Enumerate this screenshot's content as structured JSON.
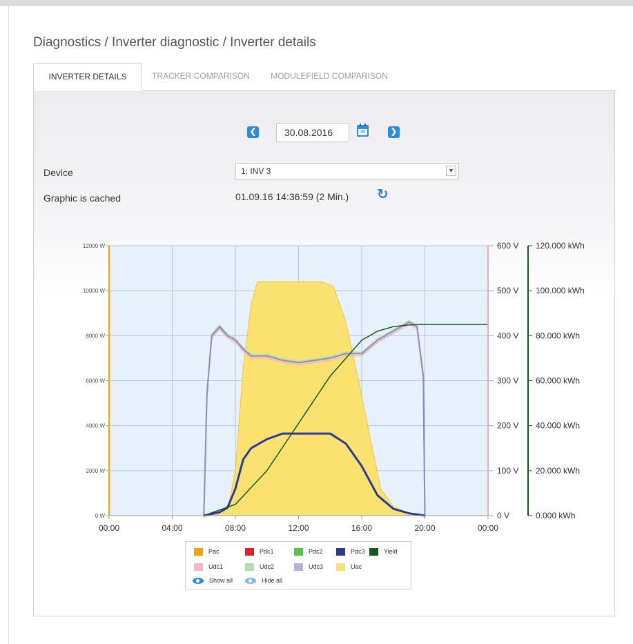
{
  "breadcrumb": "Diagnostics / Inverter diagnostic / Inverter details",
  "tabs": [
    {
      "label": "INVERTER DETAILS",
      "active": true
    },
    {
      "label": "TRACKER COMPARISON",
      "active": false
    },
    {
      "label": "MODULEFIELD COMPARISON",
      "active": false
    }
  ],
  "date_nav": {
    "prev_icon": "chevron-left-icon",
    "date": "30.08.2016",
    "calendar_icon": "calendar-icon",
    "calendar_day": "30",
    "next_icon": "chevron-right-icon"
  },
  "device": {
    "label": "Device",
    "selected": "1: INV 3"
  },
  "cache": {
    "label": "Graphic is cached",
    "value": "01.09.16 14:36:59 (2 Min.)",
    "refresh_icon": "refresh-icon"
  },
  "colors": {
    "Pac": "#f5a300",
    "Pdc1": "#e3222a",
    "Pdc2": "#5cc04a",
    "Pdc3": "#2a3a96",
    "Yield": "#17561c",
    "Udc1": "#f4b8c4",
    "Udc2": "#b8dbb0",
    "Udc3": "#b4b2d8",
    "Uac": "#fbe270",
    "plot_bg": "#e7f1fb",
    "grid": "#b8c8d8",
    "accent": "#2f8bd6"
  },
  "chart_data": {
    "type": "area",
    "x_unit": "time of day",
    "x_ticks": [
      "00:00",
      "04:00",
      "08:00",
      "12:00",
      "16:00",
      "20:00",
      "00:00"
    ],
    "x_range": [
      0,
      24
    ],
    "y_left": {
      "ticks": [
        "0 W",
        "2000 W",
        "4000 W",
        "6000 W",
        "8000 W",
        "10000 W",
        "12000 W"
      ],
      "range": [
        0,
        12000
      ]
    },
    "y_right_voltage": {
      "ticks": [
        "0 V",
        "100 V",
        "200 V",
        "300 V",
        "400 V",
        "500 V",
        "600 V"
      ],
      "range": [
        0,
        600
      ]
    },
    "y_right_yield": {
      "ticks": [
        "0.000 kWh",
        "20.000 kWh",
        "40.000 kWh",
        "60.000 kWh",
        "80.000 kWh",
        "100.000 kWh",
        "120.000 kWh"
      ],
      "range": [
        0,
        120
      ]
    },
    "grid": true,
    "legend_placement": "bottom-center",
    "series": [
      {
        "name": "Uac",
        "axis": "V",
        "x": [
          6.5,
          7.2,
          7.6,
          8.0,
          8.5,
          9.0,
          9.4,
          10.5,
          12.0,
          13.5,
          14.2,
          15.0,
          15.8,
          16.5,
          17.2,
          18.0,
          19.0,
          20.0
        ],
        "values": [
          0,
          5,
          30,
          100,
          330,
          470,
          520,
          520,
          520,
          520,
          510,
          430,
          300,
          180,
          60,
          20,
          5,
          0
        ]
      },
      {
        "name": "Udc3",
        "axis": "V",
        "x": [
          6.0,
          6.2,
          6.5,
          7.0,
          7.5,
          8.0,
          8.5,
          9.0,
          10.0,
          11.0,
          12.0,
          13.0,
          14.0,
          15.0,
          16.0,
          17.0,
          18.0,
          19.0,
          19.5,
          19.9,
          20.0
        ],
        "values": [
          0,
          270,
          400,
          420,
          400,
          390,
          370,
          355,
          355,
          345,
          340,
          345,
          350,
          360,
          360,
          390,
          410,
          430,
          420,
          310,
          0
        ]
      },
      {
        "name": "Pdc3",
        "axis": "W",
        "x": [
          6.0,
          7.0,
          7.5,
          8.0,
          8.5,
          9.0,
          10.0,
          11.0,
          12.0,
          13.0,
          14.0,
          15.0,
          16.0,
          17.0,
          18.0,
          19.0,
          20.0
        ],
        "values": [
          0,
          150,
          350,
          1200,
          2500,
          3000,
          3400,
          3650,
          3650,
          3650,
          3650,
          3200,
          2200,
          900,
          300,
          100,
          0
        ]
      },
      {
        "name": "Yield",
        "axis": "kWh",
        "x": [
          6.0,
          8.0,
          10.0,
          12.0,
          14.0,
          16.0,
          17.0,
          18.0,
          19.0,
          20.0,
          24.0
        ],
        "values": [
          0,
          5,
          20,
          41,
          62,
          78,
          82,
          84,
          84.8,
          85,
          85
        ]
      }
    ],
    "legend": [
      {
        "name": "Pac",
        "icon": "square"
      },
      {
        "name": "Pdc1",
        "icon": "square"
      },
      {
        "name": "Pdc2",
        "icon": "square"
      },
      {
        "name": "Pdc3",
        "icon": "square"
      },
      {
        "name": "Yield",
        "icon": "square"
      },
      {
        "name": "Udc1",
        "icon": "square"
      },
      {
        "name": "Udc2",
        "icon": "square"
      },
      {
        "name": "Udc3",
        "icon": "square"
      },
      {
        "name": "Uac",
        "icon": "square"
      }
    ],
    "legend_actions": {
      "show_all": "Show all",
      "hide_all": "Hide all",
      "show_icon": "eye-icon",
      "hide_icon": "eye-hidden-icon"
    }
  }
}
